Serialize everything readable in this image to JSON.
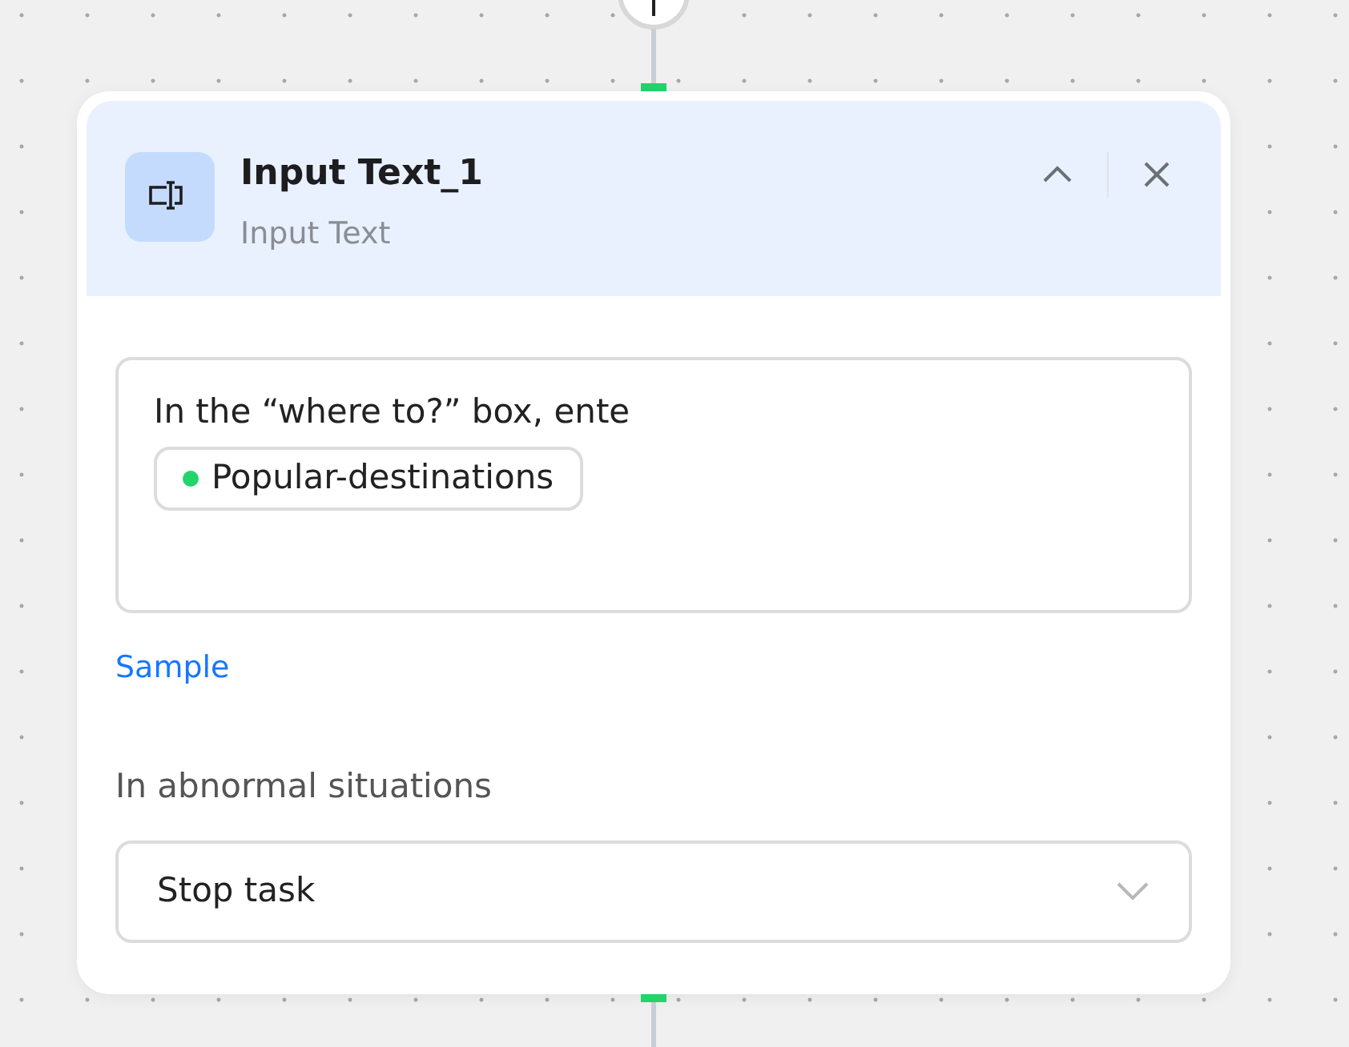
{
  "node": {
    "title": "Input Text_1",
    "subtitle": "Input Text",
    "expanded": true
  },
  "input": {
    "text": "In the “where to?” box, ente",
    "variables": [
      {
        "label": "Popular-destinations",
        "color": "#22d46b"
      }
    ]
  },
  "sample_link": "Sample",
  "abnormal": {
    "label": "In abnormal situations",
    "value": "Stop task"
  }
}
